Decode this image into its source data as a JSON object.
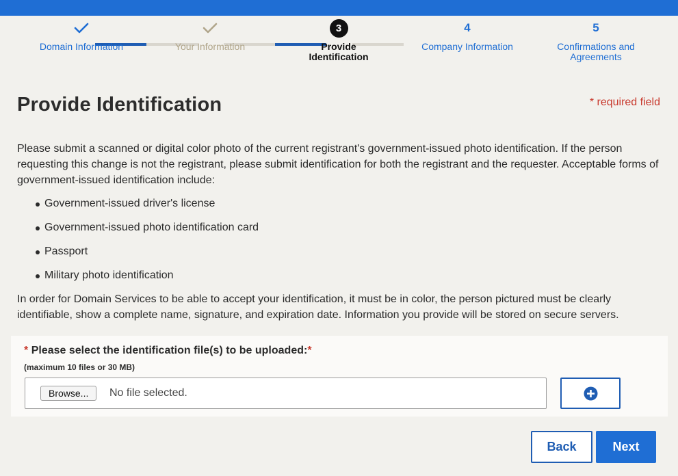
{
  "colors": {
    "accent": "#1f6ed4",
    "completed_blue": "#1f6ed4",
    "completed_muted": "#b0a58a",
    "required_red": "#c8382c"
  },
  "stepper": {
    "steps": [
      {
        "label": "Domain Information",
        "marker": "",
        "icon": "check-icon",
        "state": "completed"
      },
      {
        "label": "Your Information",
        "marker": "",
        "icon": "check-icon",
        "state": "completed-muted"
      },
      {
        "label": "Provide Identification",
        "marker": "3",
        "state": "current"
      },
      {
        "label": "Company Information",
        "marker": "4",
        "state": "upcoming"
      },
      {
        "label": "Confirmations and Agreements",
        "marker": "5",
        "state": "upcoming"
      }
    ]
  },
  "page": {
    "title": "Provide Identification",
    "required_note": "* required field",
    "intro": "Please submit a scanned or digital color photo of the current registrant's government-issued photo identification. If the person requesting this change is not the registrant, please submit identification for both the registrant and the requester. Acceptable forms of government-issued identification include:",
    "id_types": [
      "Government-issued driver's license",
      "Government-issued photo identification card",
      "Passport",
      "Military photo identification"
    ],
    "outro": "In order for Domain Services to be able to accept your identification, it must be in color, the person pictured must be clearly identifiable, show a complete name, signature, and expiration date. Information you provide will be stored on secure servers."
  },
  "upload": {
    "star": "*",
    "label": "Please select the identification file(s) to be uploaded:",
    "sublabel": "(maximum 10 files or 30 MB)",
    "browse_label": "Browse...",
    "file_status": "No file selected.",
    "add_icon": "plus-circle-icon"
  },
  "buttons": {
    "back": "Back",
    "next": "Next"
  }
}
